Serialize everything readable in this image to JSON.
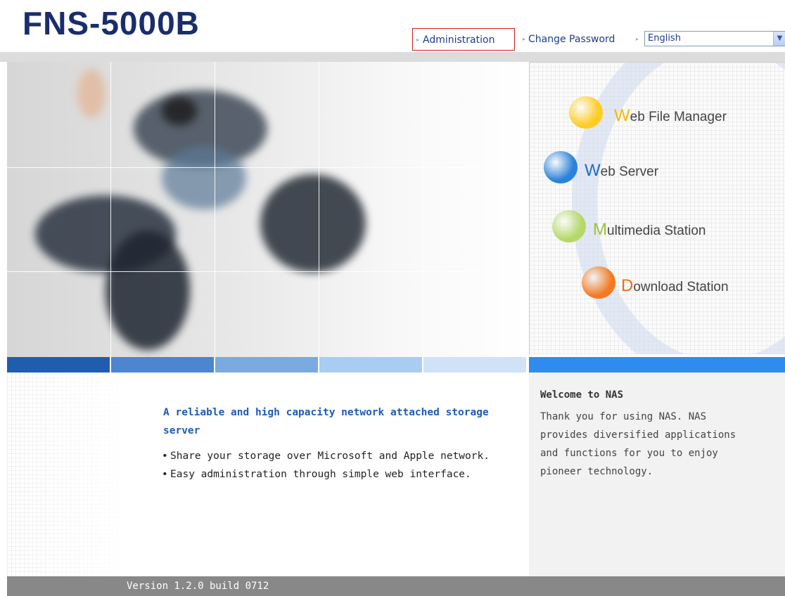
{
  "header": {
    "logo": "FNS-5000B",
    "links": {
      "administration": "Administration",
      "change_password": "Change Password"
    },
    "language": {
      "selected": "English"
    }
  },
  "apps": [
    {
      "initial": "W",
      "rest": "eb File Manager",
      "initial_color": "#f5b800",
      "ball_color": "#ffcc22"
    },
    {
      "initial": "W",
      "rest": "eb Server",
      "initial_color": "#1f6bc4",
      "ball_color": "#2a82da"
    },
    {
      "initial": "M",
      "rest": "ultimedia Station",
      "initial_color": "#9bc23a",
      "ball_color": "#b6d86a"
    },
    {
      "initial": "D",
      "rest": "ownload Station",
      "initial_color": "#ee6a1c",
      "ball_color": "#f27a22"
    }
  ],
  "colorbar": [
    "#1f5eae",
    "#4b86cf",
    "#7aaae0",
    "#a9ccf2",
    "#cfe2f8",
    "#ffffff",
    "#2e8cee"
  ],
  "tagline": "A reliable and high capacity network attached storage server",
  "features": [
    "Share your storage over Microsoft and Apple network.",
    "Easy administration through simple web interface."
  ],
  "welcome": {
    "title": "Welcome to NAS",
    "body": "Thank you for using NAS. NAS provides diversified applications and functions for you to enjoy pioneer technology."
  },
  "footer": {
    "version": "Version 1.2.0 build 0712"
  }
}
